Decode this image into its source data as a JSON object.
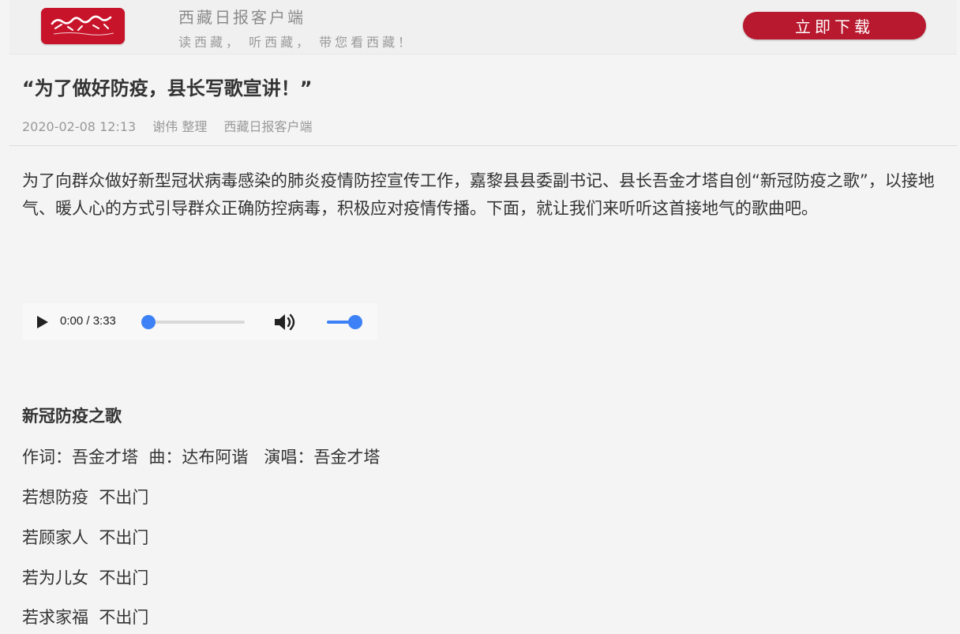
{
  "banner": {
    "brand_name": "西藏日报客户端",
    "slogan": "读西藏， 听西藏， 带您看西藏！",
    "download_label": "立即下载",
    "logo_text": "西藏日报"
  },
  "article": {
    "title": "“为了做好防疫，县长写歌宣讲！”",
    "meta": {
      "datetime": "2020-02-08 12:13",
      "author": "谢伟 整理",
      "source": "西藏日报客户端"
    },
    "intro": "为了向群众做好新型冠状病毒感染的肺炎疫情防控宣传工作，嘉黎县县委副书记、县长吾金才塔自创“新冠防疫之歌”，以接地气、暖人心的方式引导群众正确防控病毒，积极应对疫情传播。下面，就让我们来听听这首接地气的歌曲吧。"
  },
  "audio": {
    "time_display": "0:00 / 3:33",
    "progress_fraction": 0,
    "volume_fraction": 1
  },
  "song": {
    "title": "新冠防疫之歌",
    "credits": "作词：吾金才塔  曲：达布阿谐   演唱：吾金才塔",
    "lines": [
      "若想防疫  不出门",
      "若顾家人  不出门",
      "若为儿女  不出门",
      "若求家福  不出门"
    ]
  },
  "colors": {
    "brand_red": "#b8192e",
    "player_accent": "#3c82f6",
    "background": "#f4f4f4"
  },
  "icons": {
    "play": "play-icon",
    "volume": "volume-icon"
  }
}
